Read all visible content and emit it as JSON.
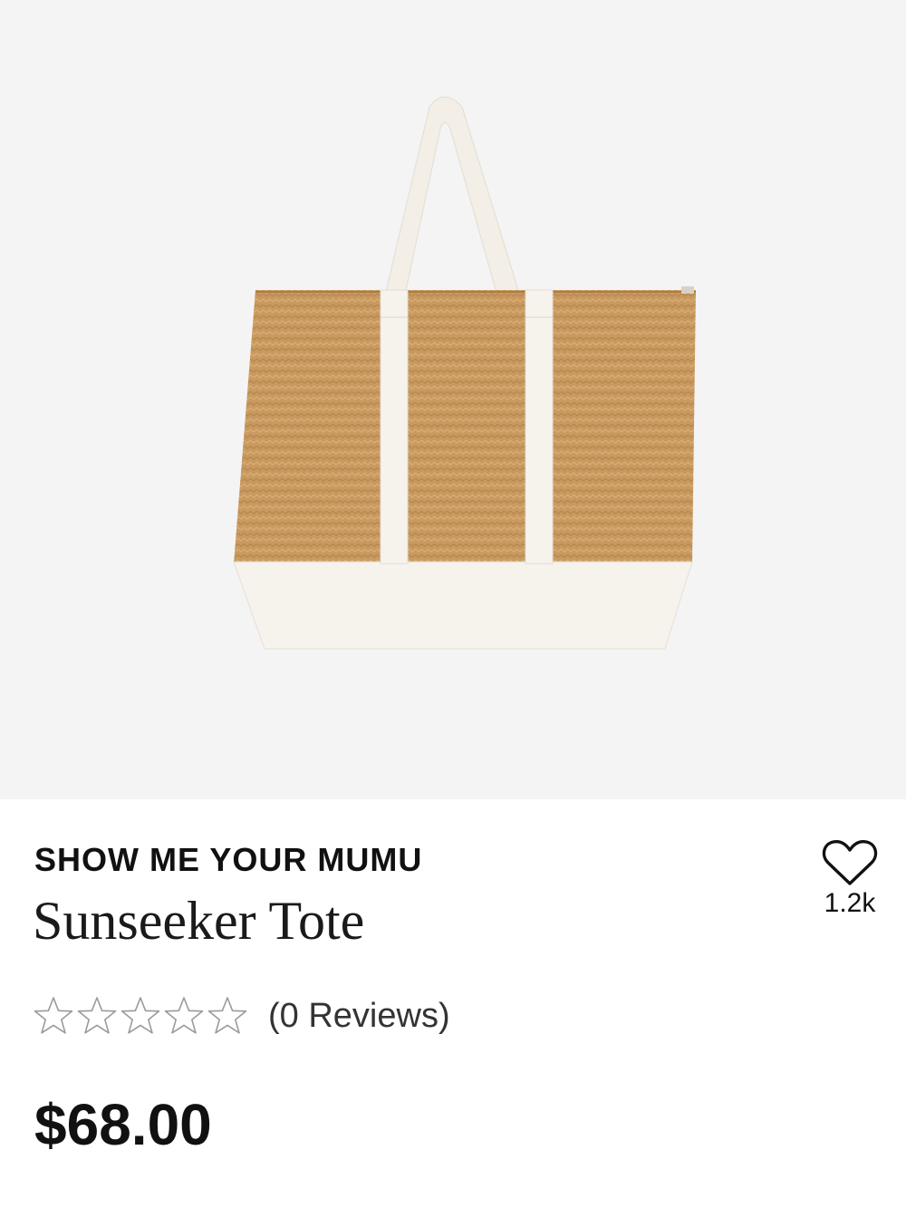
{
  "product": {
    "image": {
      "icon": "straw-tote-bag-image",
      "colors": {
        "background": "#f4f4f4",
        "straw": "#c99a60",
        "canvas": "#f6f3ec"
      }
    },
    "brand": "SHOW ME YOUR MUMU",
    "name": "Sunseeker Tote",
    "favorite": {
      "icon": "heart-outline-icon",
      "count": "1.2k"
    },
    "rating": {
      "stars_filled": 0,
      "stars_total": 5,
      "star_icon": "star-outline-icon",
      "reviews_label": "(0 Reviews)"
    },
    "price": "$68.00"
  }
}
